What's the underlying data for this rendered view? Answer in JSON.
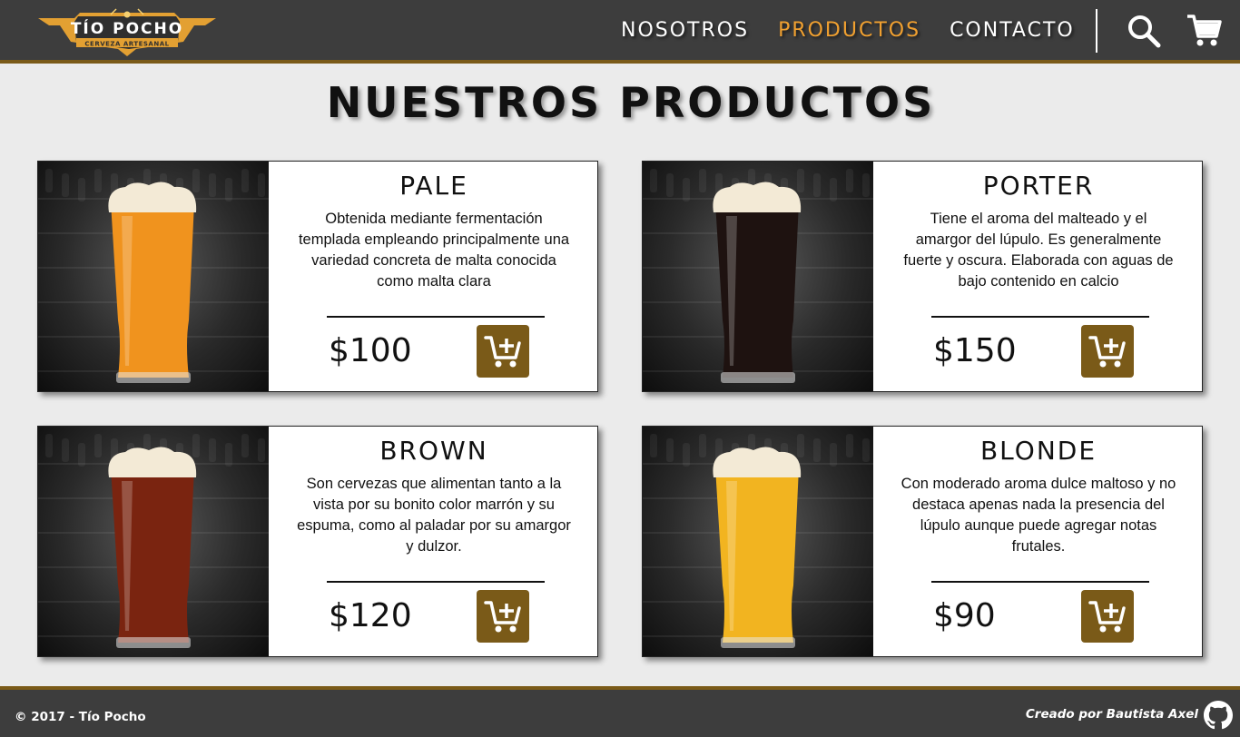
{
  "header": {
    "logo": {
      "title": "TÍO POCHO",
      "subtitle": "CERVEZA ARTESANAL"
    },
    "nav": [
      {
        "label": "NOSOTROS",
        "active": false
      },
      {
        "label": "PRODUCTOS",
        "active": true
      },
      {
        "label": "CONTACTO",
        "active": false
      }
    ],
    "icons": [
      "search-icon",
      "cart-icon"
    ]
  },
  "main": {
    "title": "NUESTROS PRODUCTOS",
    "products": [
      {
        "name": "PALE",
        "description": "Obtenida mediante fermentación templada empleando principalmente una variedad concreta de malta conocida como malta clara",
        "price": "$100",
        "beer_color": "#f0931e"
      },
      {
        "name": "PORTER",
        "description": "Tiene el aroma del malteado y el amargor del lúpulo. Es generalmente fuerte y oscura.  Elaborada con aguas de bajo contenido en calcio",
        "price": "$150",
        "beer_color": "#1e1210"
      },
      {
        "name": "BROWN",
        "description": "Son cervezas que alimentan tanto a la vista por su bonito color marrón y su espuma, como al paladar por su amargor y dulzor.",
        "price": "$120",
        "beer_color": "#7a2410"
      },
      {
        "name": "BLONDE",
        "description": "Con moderado aroma dulce maltoso y no destaca apenas nada la presencia del lúpulo aunque puede agregar notas frutales.",
        "price": "$90",
        "beer_color": "#f2b420"
      }
    ]
  },
  "footer": {
    "copyright": "© 2017 - Tío Pocho",
    "credit": "Creado por Bautista Axel"
  },
  "colors": {
    "header_bg": "#3d3d3d",
    "accent": "#7a5a18",
    "active_nav": "#f0a030",
    "page_bg": "#ebebeb"
  }
}
